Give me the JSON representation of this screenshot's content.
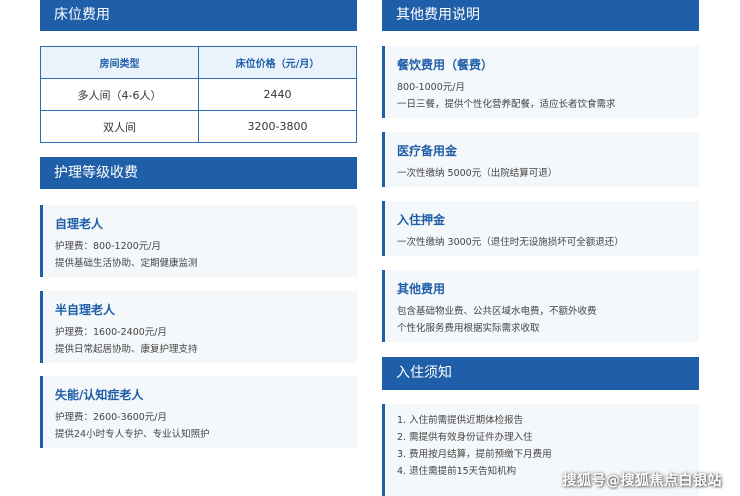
{
  "left": {
    "bed_fee": {
      "header": "床位费用",
      "table": {
        "columns": [
          "房间类型",
          "床位价格（元/月）"
        ],
        "rows": [
          [
            "多人间（4-6人）",
            "2440"
          ],
          [
            "双人间",
            "3200-3800"
          ]
        ]
      }
    },
    "care_fee": {
      "header": "护理等级收费",
      "cards": [
        {
          "title": "自理老人",
          "line1": "护理费：800-1200元/月",
          "line2": "提供基础生活协助、定期健康监测"
        },
        {
          "title": "半自理老人",
          "line1": "护理费：1600-2400元/月",
          "line2": "提供日常起居协助、康复护理支持"
        },
        {
          "title": "失能/认知症老人",
          "line1": "护理费：2600-3600元/月",
          "line2": "提供24小时专人专护、专业认知照护"
        }
      ]
    }
  },
  "right": {
    "other_fee": {
      "header": "其他费用说明",
      "cards": [
        {
          "title": "餐饮费用（餐费）",
          "line1": "800-1000元/月",
          "line2": "一日三餐，提供个性化营养配餐，适应长者饮食需求"
        },
        {
          "title": "医疗备用金",
          "line1": "一次性缴纳 5000元（出院结算可退）"
        },
        {
          "title": "入住押金",
          "line1": "一次性缴纳 3000元（退住时无设施损坏可全额退还）"
        },
        {
          "title": "其他费用",
          "line1": "包含基础物业费、公共区域水电费，不额外收费",
          "line2": "个性化服务费用根据实际需求收取"
        }
      ]
    },
    "notice": {
      "header": "入住须知",
      "items": [
        "1. 入住前需提供近期体检报告",
        "2. 需提供有效身份证件办理入住",
        "3. 费用按月结算，提前预缴下月费用",
        "4. 退住需提前15天告知机构"
      ]
    }
  },
  "watermark": "搜狐号@搜狐焦点白银站"
}
